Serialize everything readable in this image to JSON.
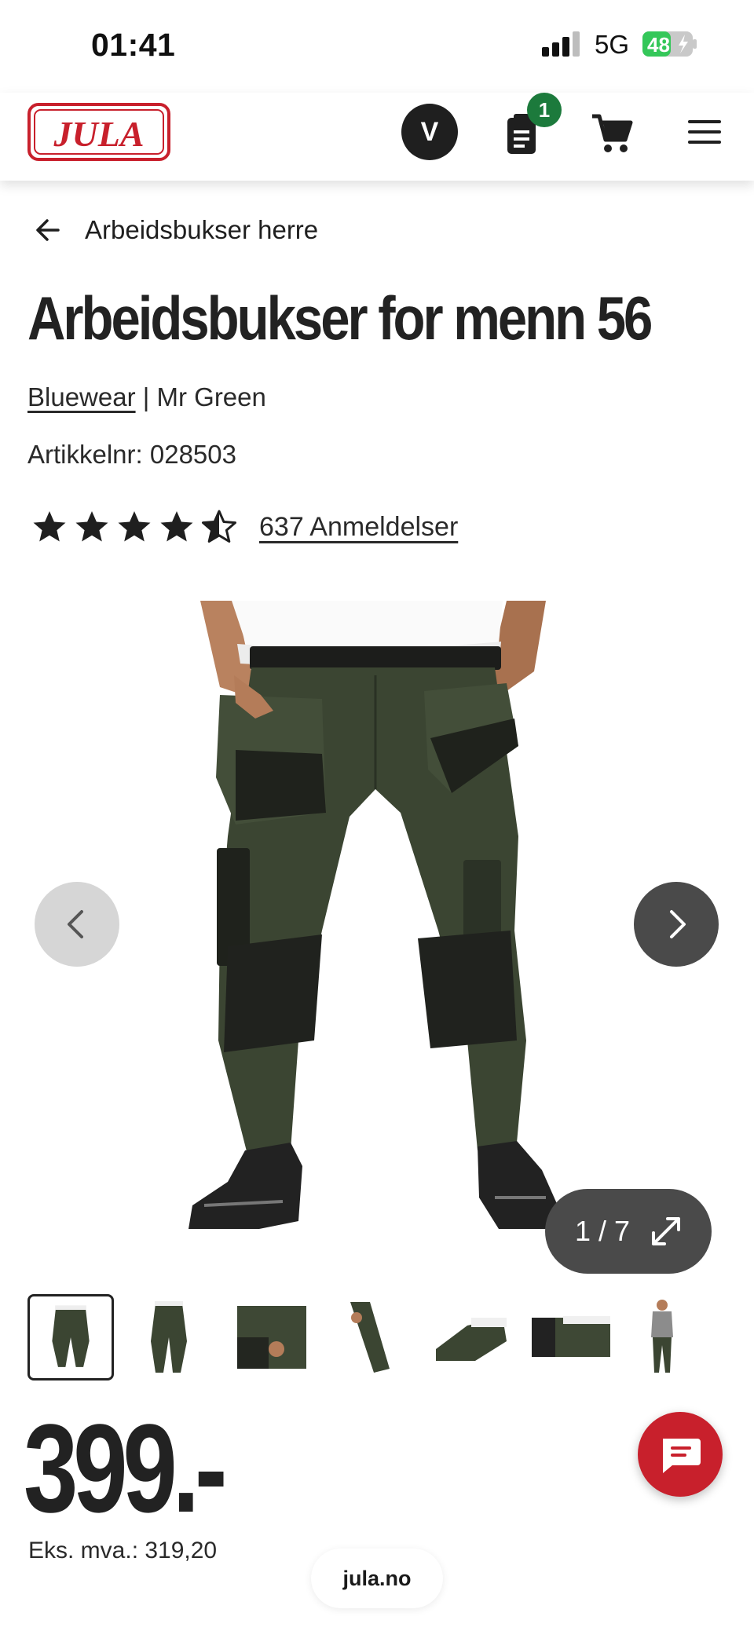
{
  "status_bar": {
    "time": "01:41",
    "network": "5G",
    "battery": "48"
  },
  "header": {
    "logo_text": "JULA",
    "avatar_initial": "V",
    "list_badge_count": "1",
    "colors": {
      "brand_red": "#c8202c",
      "badge_green": "#1c7a3c"
    }
  },
  "breadcrumb": {
    "back_label": "Arbeidsbukser herre"
  },
  "product": {
    "title": "Arbeidsbukser for menn 56",
    "brand": "Bluewear",
    "separator": " | ",
    "variant": "Mr Green",
    "article_number": "Artikkelnr: 028503",
    "rating_value": 4.5,
    "rating_max": 5,
    "reviews_label": "637 Anmeldelser",
    "price": "399.-",
    "ex_vat": "Eks. mva.: 319,20"
  },
  "gallery": {
    "counter": "1 / 7",
    "current_index": 1,
    "total": 7,
    "thumbnails": [
      "thumb-1",
      "thumb-2",
      "thumb-3",
      "thumb-4",
      "thumb-5",
      "thumb-6",
      "thumb-7"
    ]
  },
  "browser": {
    "url": "jula.no"
  }
}
